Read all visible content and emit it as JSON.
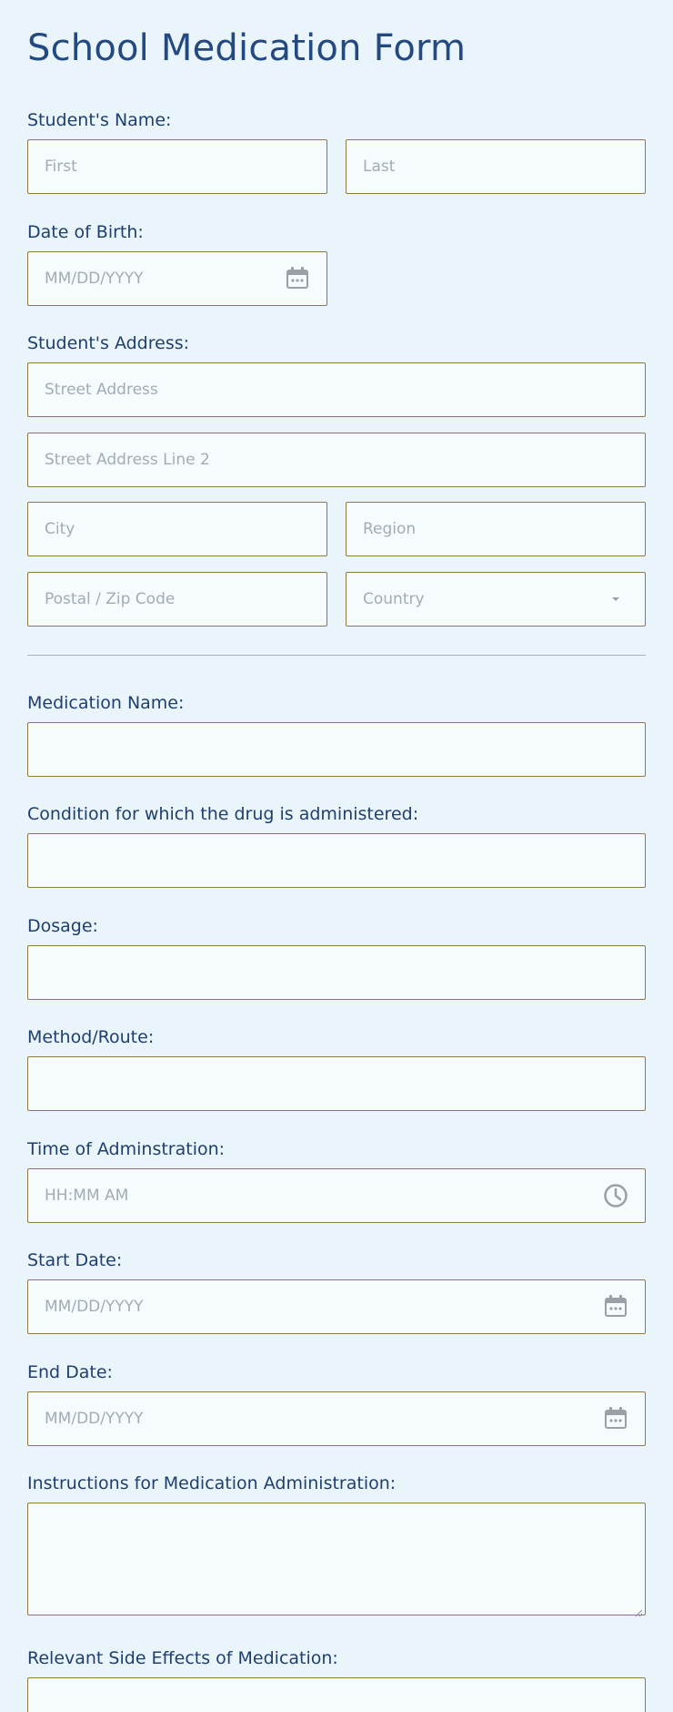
{
  "form": {
    "title": "School Medication Form",
    "student_name": {
      "label": "Student's Name:",
      "first_placeholder": "First",
      "last_placeholder": "Last"
    },
    "dob": {
      "label": "Date of Birth:",
      "placeholder": "MM/DD/YYYY"
    },
    "address": {
      "label": "Student's Address:",
      "street_placeholder": "Street Address",
      "street2_placeholder": "Street Address Line 2",
      "city_placeholder": "City",
      "region_placeholder": "Region",
      "postal_placeholder": "Postal / Zip Code",
      "country_placeholder": "Country"
    },
    "medication_name": {
      "label": "Medication Name:"
    },
    "condition": {
      "label": "Condition for which the drug is administered:"
    },
    "dosage": {
      "label": "Dosage:"
    },
    "method": {
      "label": "Method/Route:"
    },
    "time": {
      "label": "Time of Adminstration:",
      "placeholder": "HH:MM AM"
    },
    "start_date": {
      "label": "Start Date:",
      "placeholder": "MM/DD/YYYY"
    },
    "end_date": {
      "label": "End Date:",
      "placeholder": "MM/DD/YYYY"
    },
    "instructions": {
      "label": "Instructions for Medication Administration:"
    },
    "side_effects": {
      "label": "Relevant Side Effects of Medication:"
    }
  },
  "icons": {
    "calendar": "calendar-icon",
    "clock": "clock-icon",
    "caret": "caret-down-icon"
  },
  "colors": {
    "background": "#eaf4fb",
    "field_bg": "#f6fbfe",
    "border": "#8d7a45",
    "text": "#1f3f6e",
    "placeholder": "#a3abb5",
    "icon": "#9aa0a6"
  }
}
